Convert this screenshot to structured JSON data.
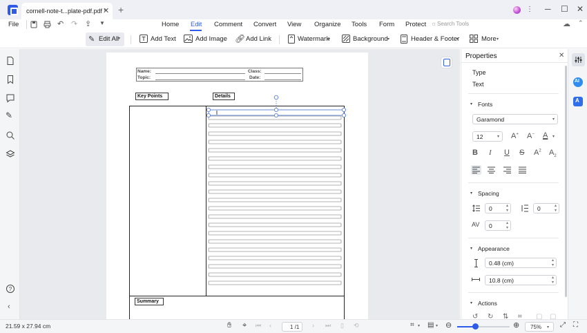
{
  "titlebar": {
    "tab_title": "cornell-note-t...plate-pdf.pdf *",
    "close_glyph": "✕",
    "new_tab_glyph": "+",
    "minimize_glyph": "─",
    "maximize_glyph": "☐",
    "close_window_glyph": "✕"
  },
  "menubar": {
    "file": "File",
    "items": [
      "Home",
      "Edit",
      "Comment",
      "Convert",
      "View",
      "Organize",
      "Tools",
      "Form",
      "Protect"
    ],
    "search_placeholder": "Search Tools"
  },
  "toolbar": {
    "edit_all": "Edit All",
    "add_text": "Add Text",
    "add_image": "Add Image",
    "add_link": "Add Link",
    "watermark": "Watermark",
    "background": "Background",
    "header_footer": "Header & Footer",
    "more": "More"
  },
  "document": {
    "name_label": "Name:",
    "class_label": "Class:",
    "topic_label": "Topic:",
    "date_label": "Date:",
    "key_points": "Key Points",
    "details": "Details",
    "summary": "Summary"
  },
  "properties": {
    "title": "Properties",
    "type_label": "Type",
    "type_value": "Text",
    "fonts_section": "Fonts",
    "font_name": "Garamond",
    "font_size": "12",
    "spacing_section": "Spacing",
    "line_spacing": "0",
    "paragraph_spacing": "0",
    "char_spacing": "0",
    "appearance_section": "Appearance",
    "height_value": "0.48 (cm)",
    "width_value": "10.8 (cm)",
    "actions_section": "Actions"
  },
  "rightrail": {
    "ai_label": "AI"
  },
  "statusbar": {
    "page_size": "21.59 x 27.94 cm",
    "page_indicator": "1 /1",
    "zoom": "75%"
  },
  "colors": {
    "accent": "#2f5bea",
    "selection": "#5a7fd6"
  }
}
